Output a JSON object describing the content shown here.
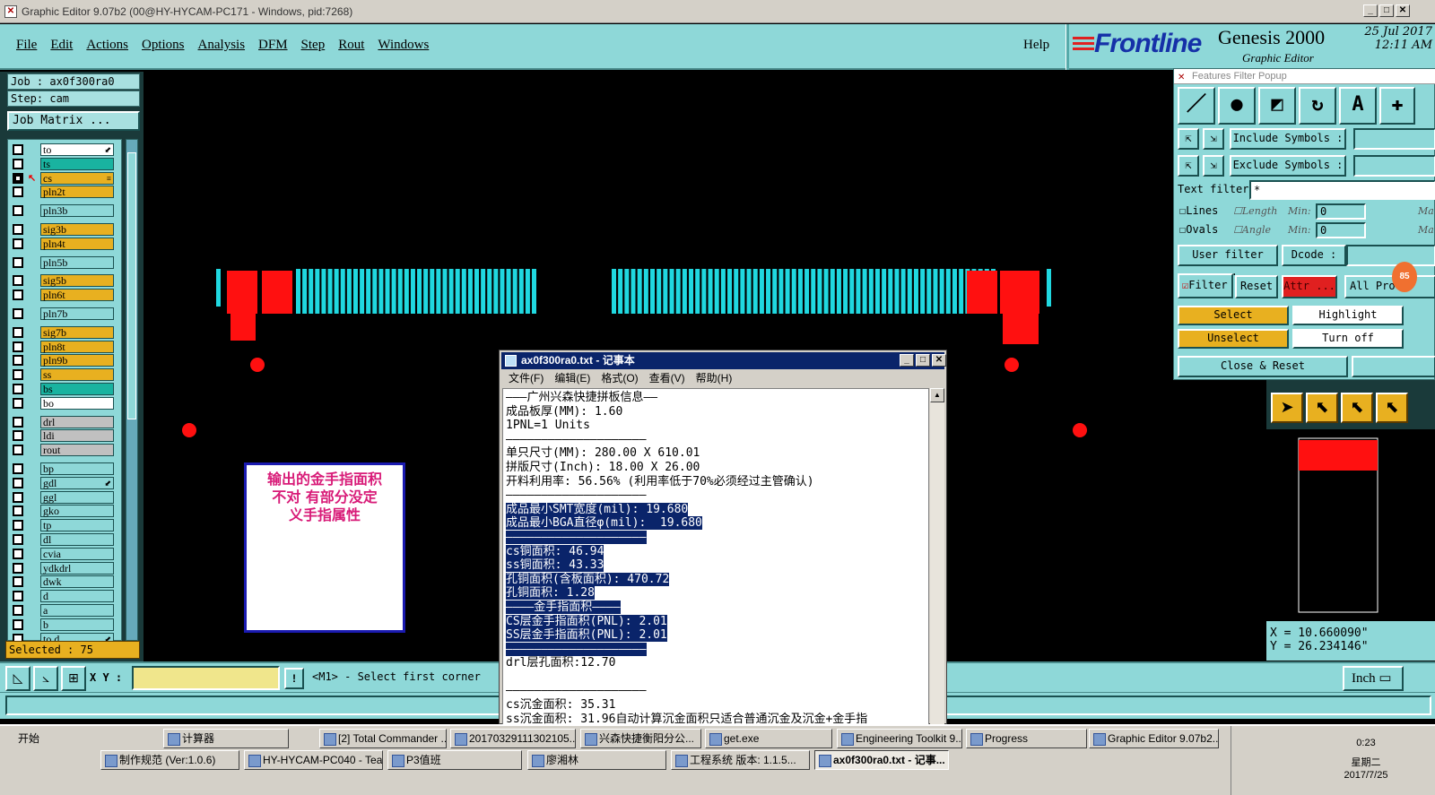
{
  "window": {
    "title": "Graphic Editor 9.07b2 (00@HY-HYCAM-PC171 - Windows, pid:7268)"
  },
  "menu": {
    "items": [
      "File",
      "Edit",
      "Actions",
      "Options",
      "Analysis",
      "DFM",
      "Step",
      "Rout",
      "Windows"
    ],
    "help": "Help"
  },
  "brand": {
    "logo": "Frontline",
    "product": "Genesis 2000",
    "product_sub": "Graphic Editor",
    "date": "25 Jul 2017",
    "time": "12:11 AM"
  },
  "job": {
    "job_label": "Job  : ax0f300ra0",
    "step_label": "Step: cam",
    "matrix_button": "Job Matrix ..."
  },
  "layers": [
    {
      "name": "to",
      "type": "board",
      "mark": "⬋"
    },
    {
      "name": "ts",
      "type": "comp"
    },
    {
      "name": "cs",
      "type": "sig",
      "selected": true,
      "mark": "≡"
    },
    {
      "name": "pln2t",
      "type": "sig"
    },
    {
      "name": "pln3b",
      "type": "plane"
    },
    {
      "name": "sig3b",
      "type": "sig"
    },
    {
      "name": "pln4t",
      "type": "sig"
    },
    {
      "name": "pln5b",
      "type": "plane"
    },
    {
      "name": "sig5b",
      "type": "sig"
    },
    {
      "name": "pln6t",
      "type": "sig"
    },
    {
      "name": "pln7b",
      "type": "plane"
    },
    {
      "name": "sig7b",
      "type": "sig"
    },
    {
      "name": "pln8t",
      "type": "sig"
    },
    {
      "name": "pln9b",
      "type": "sig"
    },
    {
      "name": "ss",
      "type": "sig"
    },
    {
      "name": "bs",
      "type": "comp"
    },
    {
      "name": "bo",
      "type": "board"
    },
    {
      "name": "drl",
      "type": "drill"
    },
    {
      "name": "ldi",
      "type": "drill"
    },
    {
      "name": "rout",
      "type": "drill"
    },
    {
      "name": "bp",
      "type": "doc"
    },
    {
      "name": "gdl",
      "type": "doc",
      "mark": "⬋"
    },
    {
      "name": "ggl",
      "type": "doc"
    },
    {
      "name": "gko",
      "type": "doc"
    },
    {
      "name": "tp",
      "type": "doc"
    },
    {
      "name": "dl",
      "type": "doc"
    },
    {
      "name": "cvia",
      "type": "doc"
    },
    {
      "name": "ydkdrl",
      "type": "doc"
    },
    {
      "name": "dwk",
      "type": "doc"
    },
    {
      "name": "d",
      "type": "doc"
    },
    {
      "name": "a",
      "type": "doc"
    },
    {
      "name": "b",
      "type": "doc"
    },
    {
      "name": "to.d",
      "type": "doc",
      "mark": "⬋"
    }
  ],
  "status": {
    "selected": "Selected : 75",
    "xy_label": "X Y :",
    "xy_value": "",
    "warn": "!",
    "message": "<M1> - Select first corner",
    "unit": "Inch",
    "coord_x": "X = 10.660090\"",
    "coord_y": "Y = 26.234146\""
  },
  "filter": {
    "title": "Features Filter Popup",
    "include_symbols": "Include Symbols :",
    "exclude_symbols": "Exclude Symbols :",
    "text_filter": "Text filter",
    "text_filter_value": "*",
    "lines": "Lines",
    "ovals": "Ovals",
    "length": "Length",
    "angle": "Angle",
    "min": "Min:",
    "min_value": "0",
    "max": "Ma",
    "user_filter": "User filter ...",
    "dcode": "Dcode :",
    "filter_cb": "Filter",
    "reset": "Reset",
    "attr": "Attr ...",
    "all_pro": "All Pro",
    "select": "Select",
    "highlight": "Highlight",
    "unselect": "Unselect",
    "turn_off": "Turn off",
    "close_reset": "Close & Reset",
    "badge": "85"
  },
  "annotation": {
    "line1": "输出的金手指面积",
    "line2": "不对  有部分没定",
    "line3": "义手指属性"
  },
  "notepad": {
    "title": "ax0f300ra0.txt - 记事本",
    "menu": [
      "文件(F)",
      "编辑(E)",
      "格式(O)",
      "查看(V)",
      "帮助(H)"
    ],
    "lines": [
      {
        "t": "———广州兴森快捷拼板信息——",
        "hl": false
      },
      {
        "t": "成品板厚(MM): 1.60",
        "hl": false
      },
      {
        "t": "1PNL=1 Units",
        "hl": false
      },
      {
        "t": "————————————————————",
        "hl": false
      },
      {
        "t": "单只尺寸(MM): 280.00 X 610.01",
        "hl": false
      },
      {
        "t": "拼版尺寸(Inch): 18.00 X 26.00",
        "hl": false
      },
      {
        "t": "开料利用率: 56.56% (利用率低于70%必须经过主管确认)",
        "hl": false
      },
      {
        "t": "————————————————————",
        "hl": false
      },
      {
        "t": "成品最小SMT宽度(mil): 19.680",
        "hl": true
      },
      {
        "t": "成品最小BGA直径φ(mil):  19.680",
        "hl": true
      },
      {
        "t": "————————————————————",
        "hl": true
      },
      {
        "t": "cs铜面积: 46.94",
        "hl": true
      },
      {
        "t": "ss铜面积: 43.33",
        "hl": true
      },
      {
        "t": "孔铜面积(含板面积): 470.72",
        "hl": true
      },
      {
        "t": "孔铜面积: 1.28",
        "hl": true
      },
      {
        "t": "————金手指面积————",
        "hl": true
      },
      {
        "t": "CS层金手指面积(PNL): 2.01",
        "hl": true
      },
      {
        "t": "SS层金手指面积(PNL): 2.01",
        "hl": true
      },
      {
        "t": "————————————————————",
        "hl": true
      },
      {
        "t": "drl层孔面积:12.70",
        "hl": false
      },
      {
        "t": "",
        "hl": false
      },
      {
        "t": "————————————————————",
        "hl": false
      },
      {
        "t": "cs沉金面积: 35.31",
        "hl": false
      },
      {
        "t": "ss沉金面积: 31.96自动计算沉金面积只适合普通沉金及沉金+金手指",
        "hl": false
      }
    ]
  },
  "taskbar": {
    "start": "开始",
    "row1": [
      "计算器",
      "[2] Total Commander ...",
      "20170329111302105...",
      "兴森快捷衡阳分公...",
      "get.exe",
      "Engineering Toolkit 9....",
      "Progress",
      "Graphic Editor 9.07b2..."
    ],
    "row2": [
      "制作规范 (Ver:1.0.6)",
      "HY-HYCAM-PC040 - Tea...",
      "P3值班",
      "廖湘林",
      "工程系统  版本: 1.1.5...",
      "ax0f300ra0.txt - 记事..."
    ],
    "clock_time": "0:23",
    "clock_day": "星期二",
    "clock_date": "2017/7/25"
  },
  "colors": {
    "teal_panel": "#8ed8d8",
    "pad_cyan": "#20d8e0",
    "pad_red": "#ff1010",
    "signal_layer": "#e8b020",
    "highlight_blue": "#0a246a"
  }
}
